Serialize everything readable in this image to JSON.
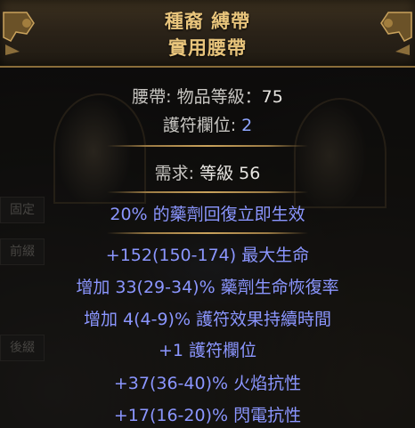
{
  "item": {
    "name": "種裔 縛帶",
    "base_type": "實用腰帶",
    "category_label": "腰帶",
    "item_level_label": "物品等級：",
    "item_level": "75",
    "charm_slots_label": "護符欄位:",
    "charm_slots": "2",
    "requirement_label": "需求:",
    "requirement_value": "等級 56",
    "implicit": "20% 的藥劑回復立即生效",
    "explicit_mods": [
      "+152(150-174) 最大生命",
      "增加 33(29-34)% 藥劑生命恢復率",
      "增加 4(4-9)% 護符效果持續時間",
      "+1 護符欄位",
      "+37(36-40)% 火焰抗性",
      "+17(16-20)% 閃電抗性"
    ]
  },
  "sidebar": {
    "implicit_label": "固定",
    "prefix_label": "前綴",
    "suffix_label": "後綴"
  },
  "colors": {
    "title": "#e9c57c",
    "mod": "#8b96ff",
    "value": "#e7e5e1"
  }
}
